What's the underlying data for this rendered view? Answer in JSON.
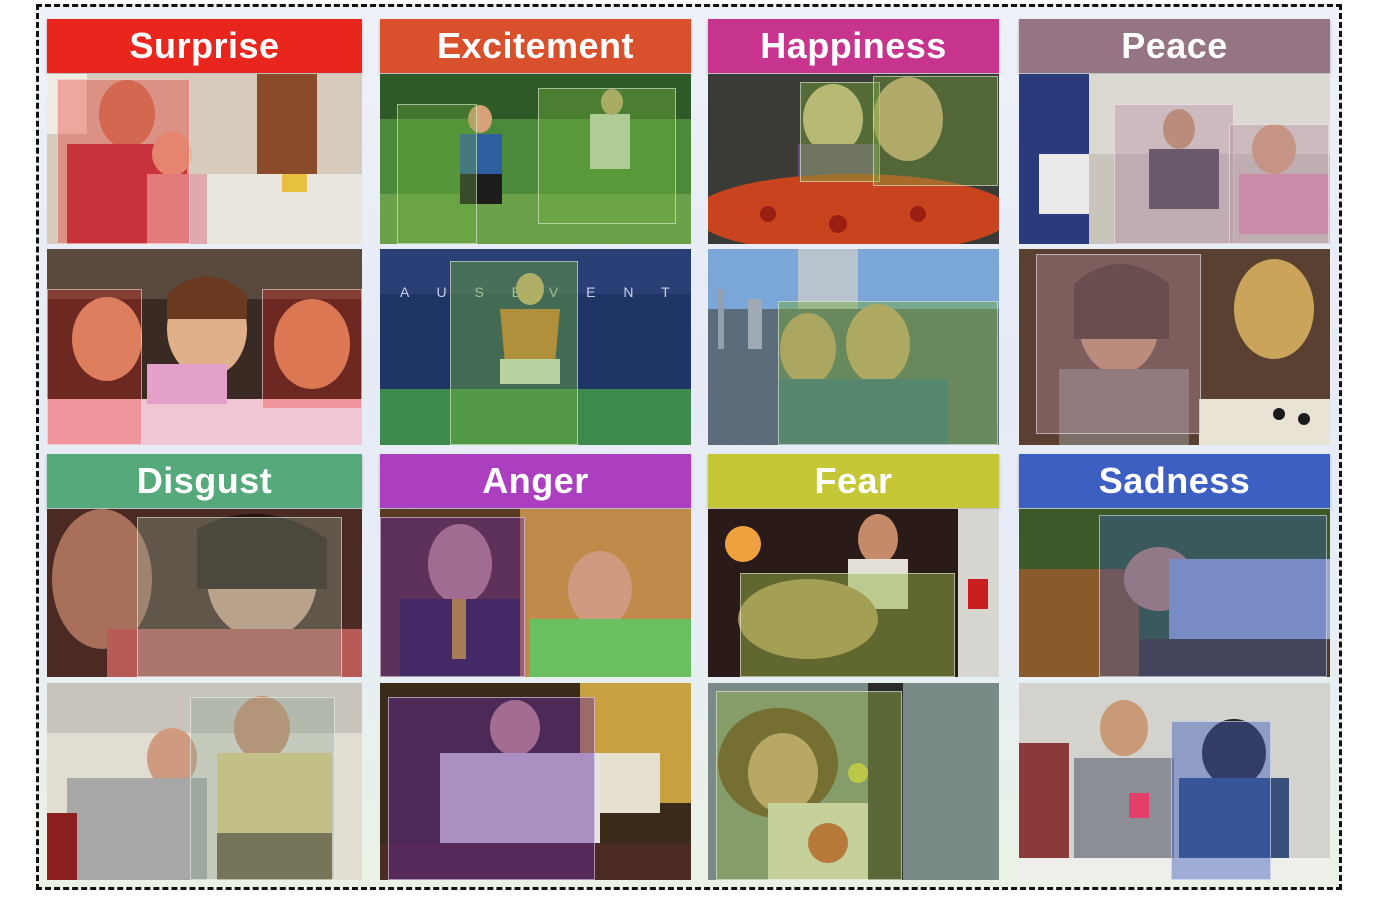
{
  "panels": [
    {
      "label": "Surprise",
      "color": "#e8261e"
    },
    {
      "label": "Excitement",
      "color": "#d9502c"
    },
    {
      "label": "Happiness",
      "color": "#c7348e"
    },
    {
      "label": "Peace",
      "color": "#957484"
    },
    {
      "label": "Disgust",
      "color": "#55a97a"
    },
    {
      "label": "Anger",
      "color": "#ac3fc0"
    },
    {
      "label": "Fear",
      "color": "#c5c737"
    },
    {
      "label": "Sadness",
      "color": "#3e5fc2"
    }
  ]
}
